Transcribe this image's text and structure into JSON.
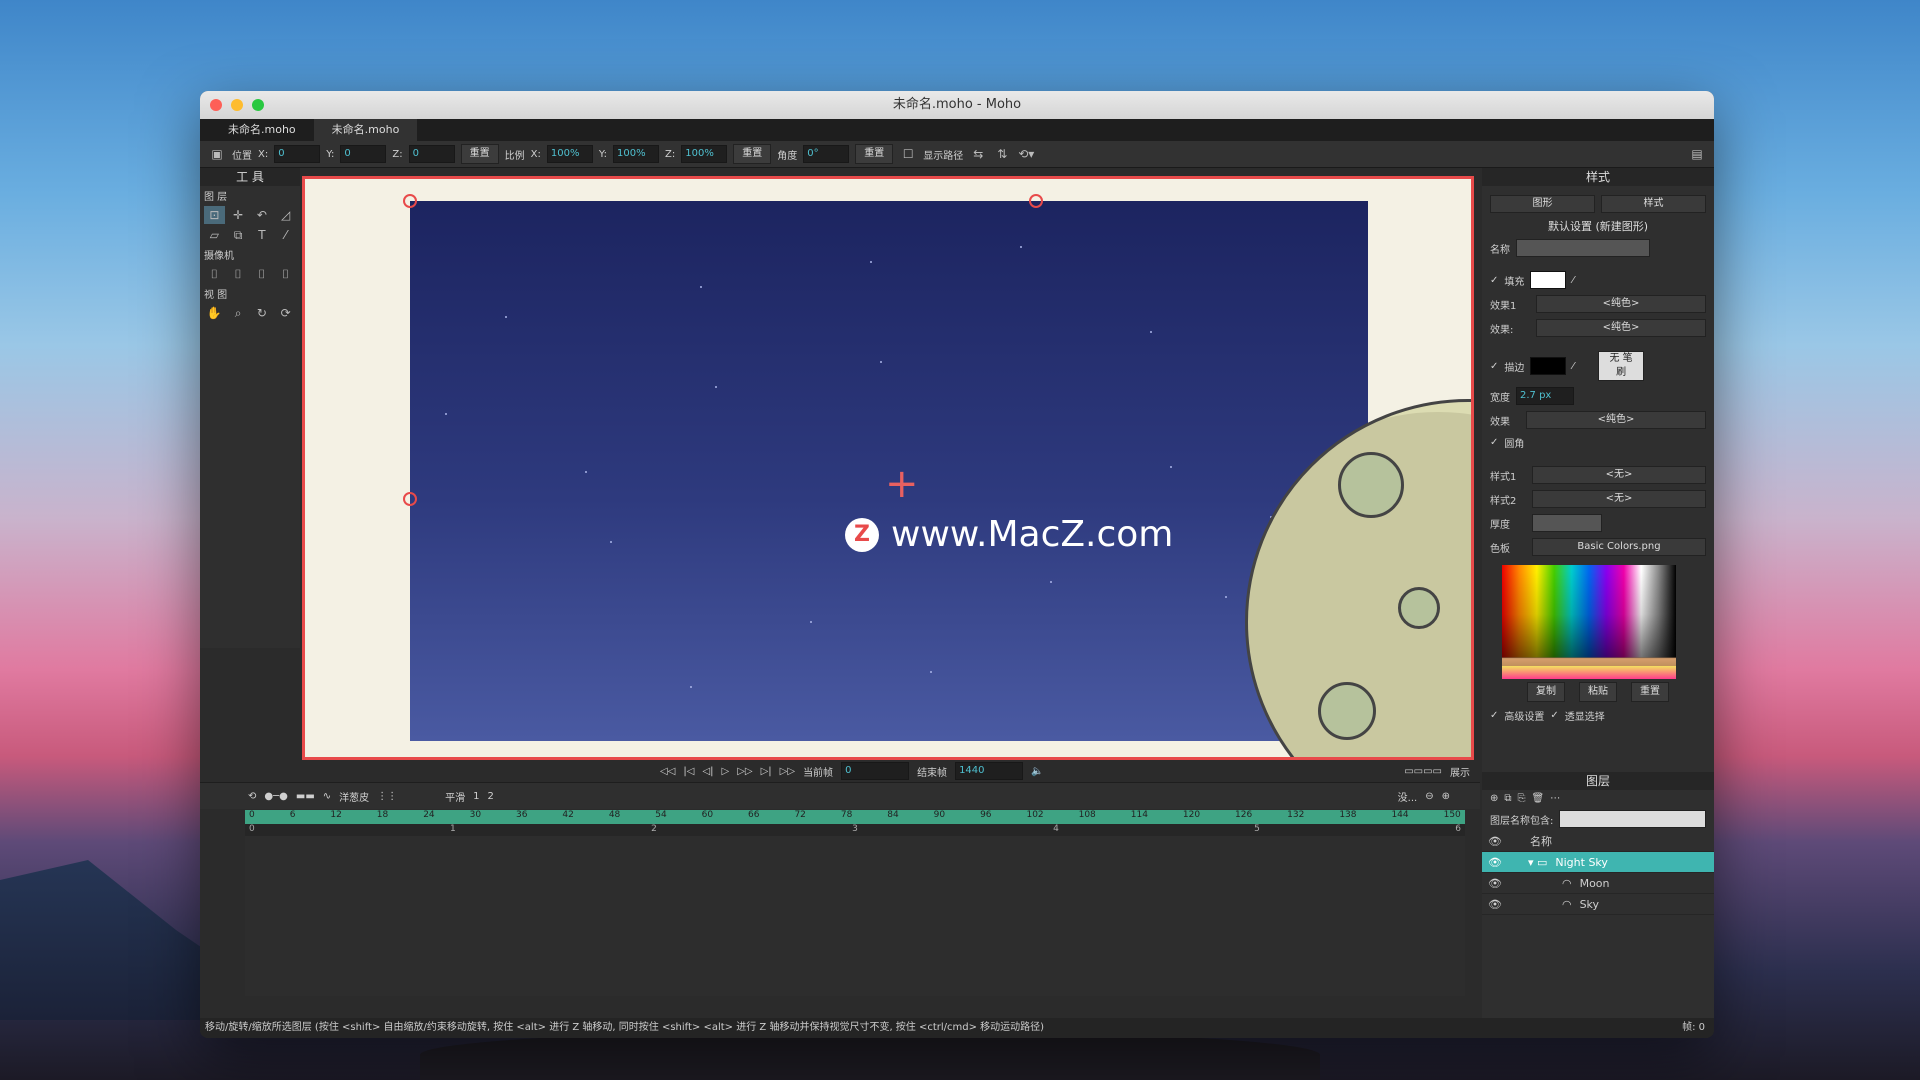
{
  "window": {
    "title": "未命名.moho - Moho"
  },
  "tabs": [
    "未命名.moho",
    "未命名.moho"
  ],
  "options_bar": {
    "position_label": "位置",
    "x_label": "X:",
    "x_value": "0",
    "y_label": "Y:",
    "y_value": "0",
    "z_label": "Z:",
    "z_value": "0",
    "reset1": "重置",
    "scale_label": "比例",
    "sx_value": "100%",
    "sy_value": "100%",
    "sz_value": "100%",
    "reset2": "重置",
    "angle_label": "角度",
    "angle_value": "0°",
    "reset3": "重置",
    "show_path": "显示路径"
  },
  "tools": {
    "title": "工 具",
    "layer_section": "图 层",
    "camera_section": "摄像机",
    "view_section": "视 图"
  },
  "canvas": {
    "watermark": "www.MacZ.com"
  },
  "style_panel": {
    "title": "样式",
    "shape_dd": "图形",
    "style_dd": "样式",
    "defaults": "默认设置 (新建图形)",
    "name_label": "名称",
    "fill_label": "填充",
    "effect1_label": "效果1",
    "effect1_value": "<纯色>",
    "effect2_label": "效果:",
    "effect2_value": "<纯色>",
    "stroke_label": "描边",
    "width_label": "宽度",
    "width_value": "2.7 px",
    "effect3_label": "效果",
    "effect3_value": "<纯色>",
    "no_brush": "无 笔刷",
    "round_label": "圆角",
    "style1_label": "样式1",
    "style1_value": "<无>",
    "style2_label": "样式2",
    "style2_value": "<无>",
    "thickness_label": "厚度",
    "palette_label": "色板",
    "palette_value": "Basic Colors.png",
    "copy_btn": "复制",
    "paste_btn": "粘贴",
    "reset_btn": "重置",
    "advanced": "高级设置",
    "transparent": "透显选择"
  },
  "layers_panel": {
    "title": "图层",
    "filter_label": "图层名称包含:",
    "col_name": "名称",
    "layers": [
      {
        "name": "Night Sky"
      },
      {
        "name": "Moon"
      },
      {
        "name": "Sky"
      }
    ]
  },
  "timeline": {
    "current_frame_label": "当前帧",
    "current_frame": "0",
    "end_frame_label": "结束帧",
    "end_frame": "1440",
    "display_label": "展示",
    "onion": "洋葱皮",
    "interp": "平滑",
    "interp_num": "1",
    "key_num": "2",
    "zoom_dd": "没...",
    "ruler": [
      "0",
      "6",
      "12",
      "18",
      "24",
      "30",
      "36",
      "42",
      "48",
      "54",
      "60",
      "66",
      "72",
      "78",
      "84",
      "90",
      "96",
      "102",
      "108",
      "114",
      "120",
      "126",
      "132",
      "138",
      "144",
      "150"
    ],
    "seconds": [
      "0",
      "1",
      "2",
      "3",
      "4",
      "5",
      "6"
    ]
  },
  "status": {
    "text": "移动/旋转/缩放所选图层 (按住 <shift> 自由缩放/约束移动旋转, 按住 <alt> 进行 Z 轴移动, 同时按住 <shift> <alt> 进行 Z 轴移动并保持视觉尺寸不变, 按住 <ctrl/cmd> 移动运动路径)",
    "frame": "帧: 0"
  }
}
